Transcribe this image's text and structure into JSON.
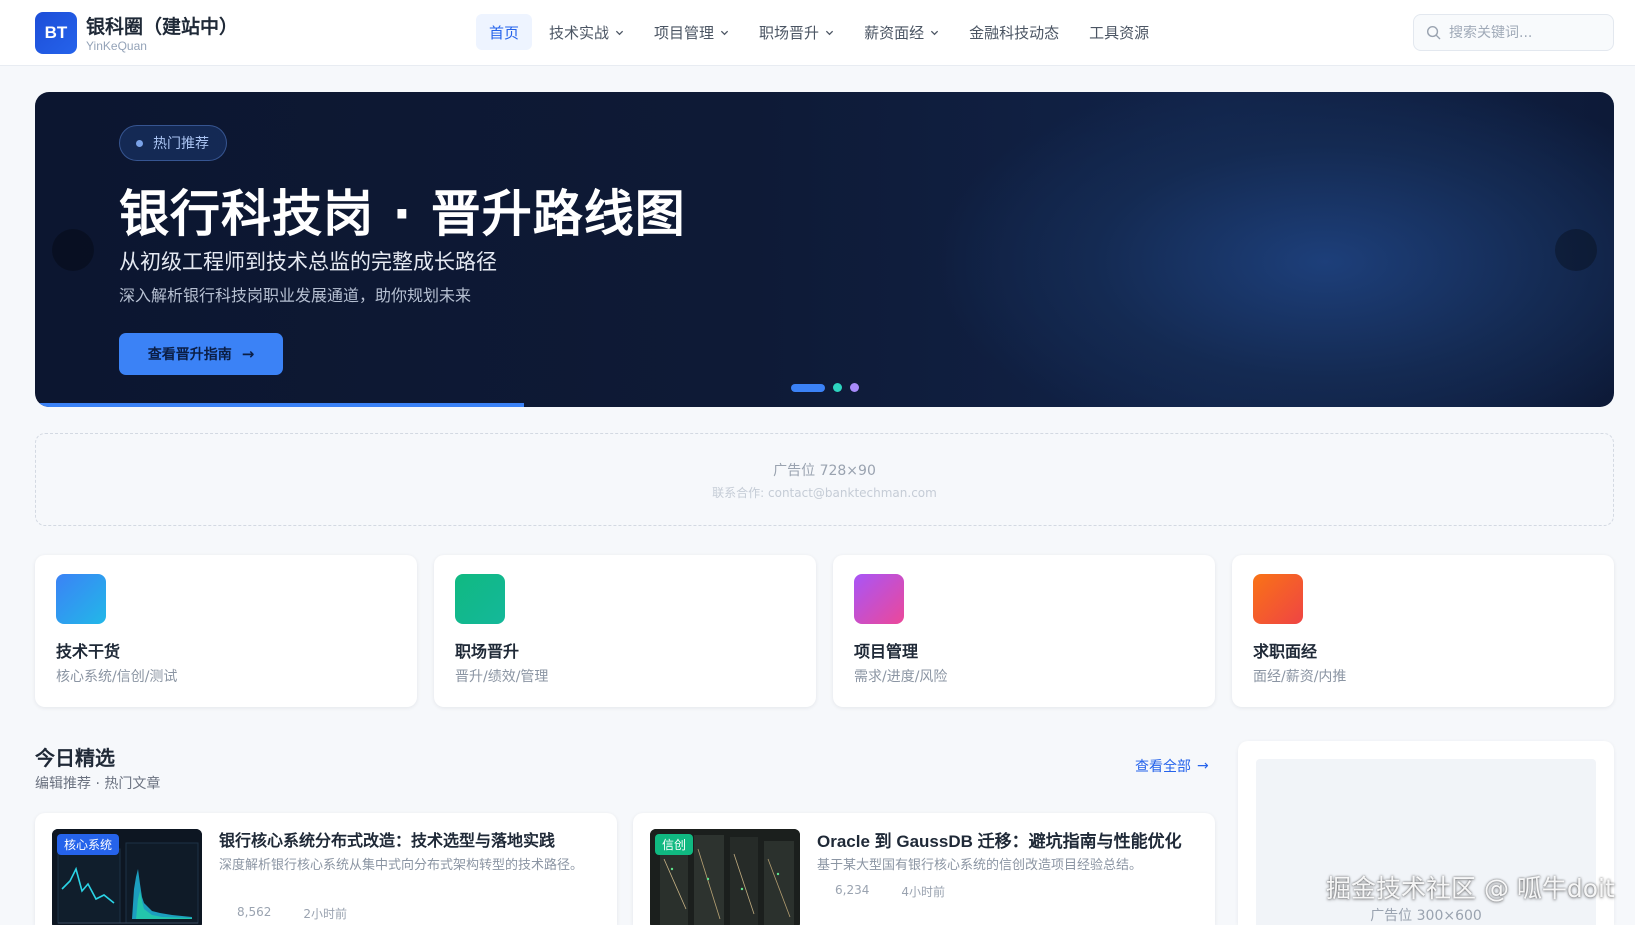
{
  "header": {
    "logo_badge": "BT",
    "site_name": "银科圈（建站中）",
    "site_name_en": "YinKeQuan",
    "nav": [
      {
        "label": "首页",
        "active": true,
        "has_dropdown": false
      },
      {
        "label": "技术实战",
        "active": false,
        "has_dropdown": true
      },
      {
        "label": "项目管理",
        "active": false,
        "has_dropdown": true
      },
      {
        "label": "职场晋升",
        "active": false,
        "has_dropdown": true
      },
      {
        "label": "薪资面经",
        "active": false,
        "has_dropdown": true
      },
      {
        "label": "金融科技动态",
        "active": false,
        "has_dropdown": false
      },
      {
        "label": "工具资源",
        "active": false,
        "has_dropdown": false
      }
    ],
    "search_placeholder": "搜索关键词..."
  },
  "hero": {
    "badge": "热门推荐",
    "title": "银行科技岗 · 晋升路线图",
    "subtitle": "从初级工程师到技术总监的完整成长路径",
    "description": "深入解析银行科技岗职业发展通道，助你规划未来",
    "cta_label": "查看晋升指南",
    "cta_arrow": "→",
    "slide_count": 3,
    "active_slide": 0,
    "dot_colors": [
      "#3b82f6",
      "#2dd4bf",
      "#a78bfa"
    ],
    "progress": 0.31
  },
  "ad_banner": {
    "title": "广告位 728×90",
    "contact": "联系合作: contact@banktechman.com"
  },
  "categories": [
    {
      "title": "技术干货",
      "subtitle": "核心系统/信创/测试",
      "color_from": "#3b82f6",
      "color_to": "#22b8e8"
    },
    {
      "title": "职场晋升",
      "subtitle": "晋升/绩效/管理",
      "color_from": "#10b981",
      "color_to": "#14b89a"
    },
    {
      "title": "项目管理",
      "subtitle": "需求/进度/风险",
      "color_from": "#a855f7",
      "color_to": "#ec4899"
    },
    {
      "title": "求职面经",
      "subtitle": "面经/薪资/内推",
      "color_from": "#f97316",
      "color_to": "#ef4444"
    }
  ],
  "featured": {
    "title": "今日精选",
    "subtitle": "编辑推荐 · 热门文章",
    "view_all": "查看全部",
    "view_all_arrow": "→",
    "articles": [
      {
        "tag": "核心系统",
        "tag_color": "#2563eb",
        "title": "银行核心系统分布式改造：技术选型与落地实践",
        "excerpt": "深度解析银行核心系统从集中式向分布式架构转型的技术路径。",
        "views": "8,562",
        "time": "2小时前"
      },
      {
        "tag": "信创",
        "tag_color": "#10b981",
        "title": "Oracle 到 GaussDB 迁移：避坑指南与性能优化",
        "excerpt": "基于某大型国有银行核心系统的信创改造项目经验总结。",
        "views": "6,234",
        "time": "4小时前"
      }
    ]
  },
  "side_ad": {
    "label": "广告位 300×600"
  },
  "watermark": "掘金技术社区 @ 呱牛doit"
}
